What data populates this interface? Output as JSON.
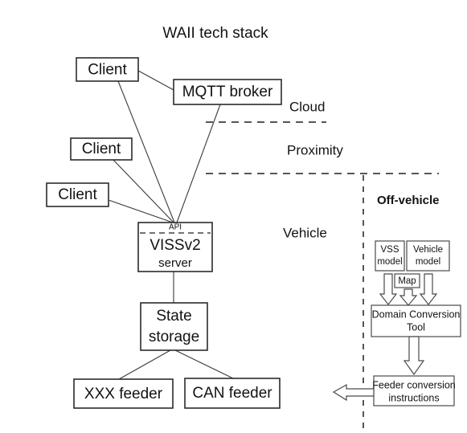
{
  "diagram": {
    "title": "WAII tech stack",
    "zones": [
      {
        "id": "cloud",
        "label": "Cloud"
      },
      {
        "id": "proximity",
        "label": "Proximity"
      },
      {
        "id": "vehicle",
        "label": "Vehicle"
      },
      {
        "id": "off-vehicle",
        "label": "Off-vehicle"
      }
    ],
    "nodes": {
      "client_1": "Client",
      "client_2": "Client",
      "client_3": "Client",
      "mqtt_broker": "MQTT broker",
      "vissv2_api": "API",
      "vissv2_name": "VISSv2",
      "vissv2_role": "server",
      "state_storage_line1": "State",
      "state_storage_line2": "storage",
      "xxx_feeder": "XXX  feeder",
      "can_feeder": "CAN feeder",
      "vss_model_line1": "VSS",
      "vss_model_line2": "model",
      "vehicle_model_line1": "Vehicle",
      "vehicle_model_line2": "model",
      "map": "Map",
      "domain_conversion_line1": "Domain Conversion",
      "domain_conversion_line2": "Tool",
      "feeder_instructions_line1": "Feeder conversion",
      "feeder_instructions_line2": "instructions"
    },
    "colors": {
      "background": "#ffffff",
      "stroke": "#2b2b2b",
      "text": "#121212",
      "divider": "#1f1f1f"
    }
  }
}
